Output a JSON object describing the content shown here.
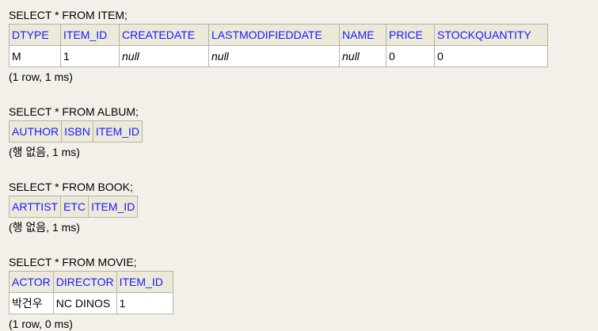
{
  "queries": [
    {
      "sql": "SELECT * FROM ITEM;",
      "columns": [
        "DTYPE",
        "ITEM_ID",
        "CREATEDATE",
        "LASTMODIFIEDDATE",
        "NAME",
        "PRICE",
        "STOCKQUANTITY"
      ],
      "rows": [
        [
          "M",
          "1",
          "null",
          "null",
          "null",
          "0",
          "0"
        ]
      ],
      "status": "(1 row, 1 ms)"
    },
    {
      "sql": "SELECT * FROM ALBUM;",
      "columns": [
        "AUTHOR",
        "ISBN",
        "ITEM_ID"
      ],
      "rows": [],
      "status": "(행 없음, 1 ms)"
    },
    {
      "sql": "SELECT * FROM BOOK;",
      "columns": [
        "ARTTIST",
        "ETC",
        "ITEM_ID"
      ],
      "rows": [],
      "status": "(행 없음, 1 ms)"
    },
    {
      "sql": "SELECT * FROM MOVIE;",
      "columns": [
        "ACTOR",
        "DIRECTOR",
        "ITEM_ID"
      ],
      "rows": [
        [
          "박건우",
          "NC DINOS",
          "1"
        ]
      ],
      "status": "(1 row, 0 ms)"
    }
  ],
  "colors": {
    "background": "#f2f0e9",
    "header_bg": "#ece9d8",
    "header_text": "#1a1aff",
    "border": "#b8b3a6",
    "cell_bg": "#ffffff"
  }
}
